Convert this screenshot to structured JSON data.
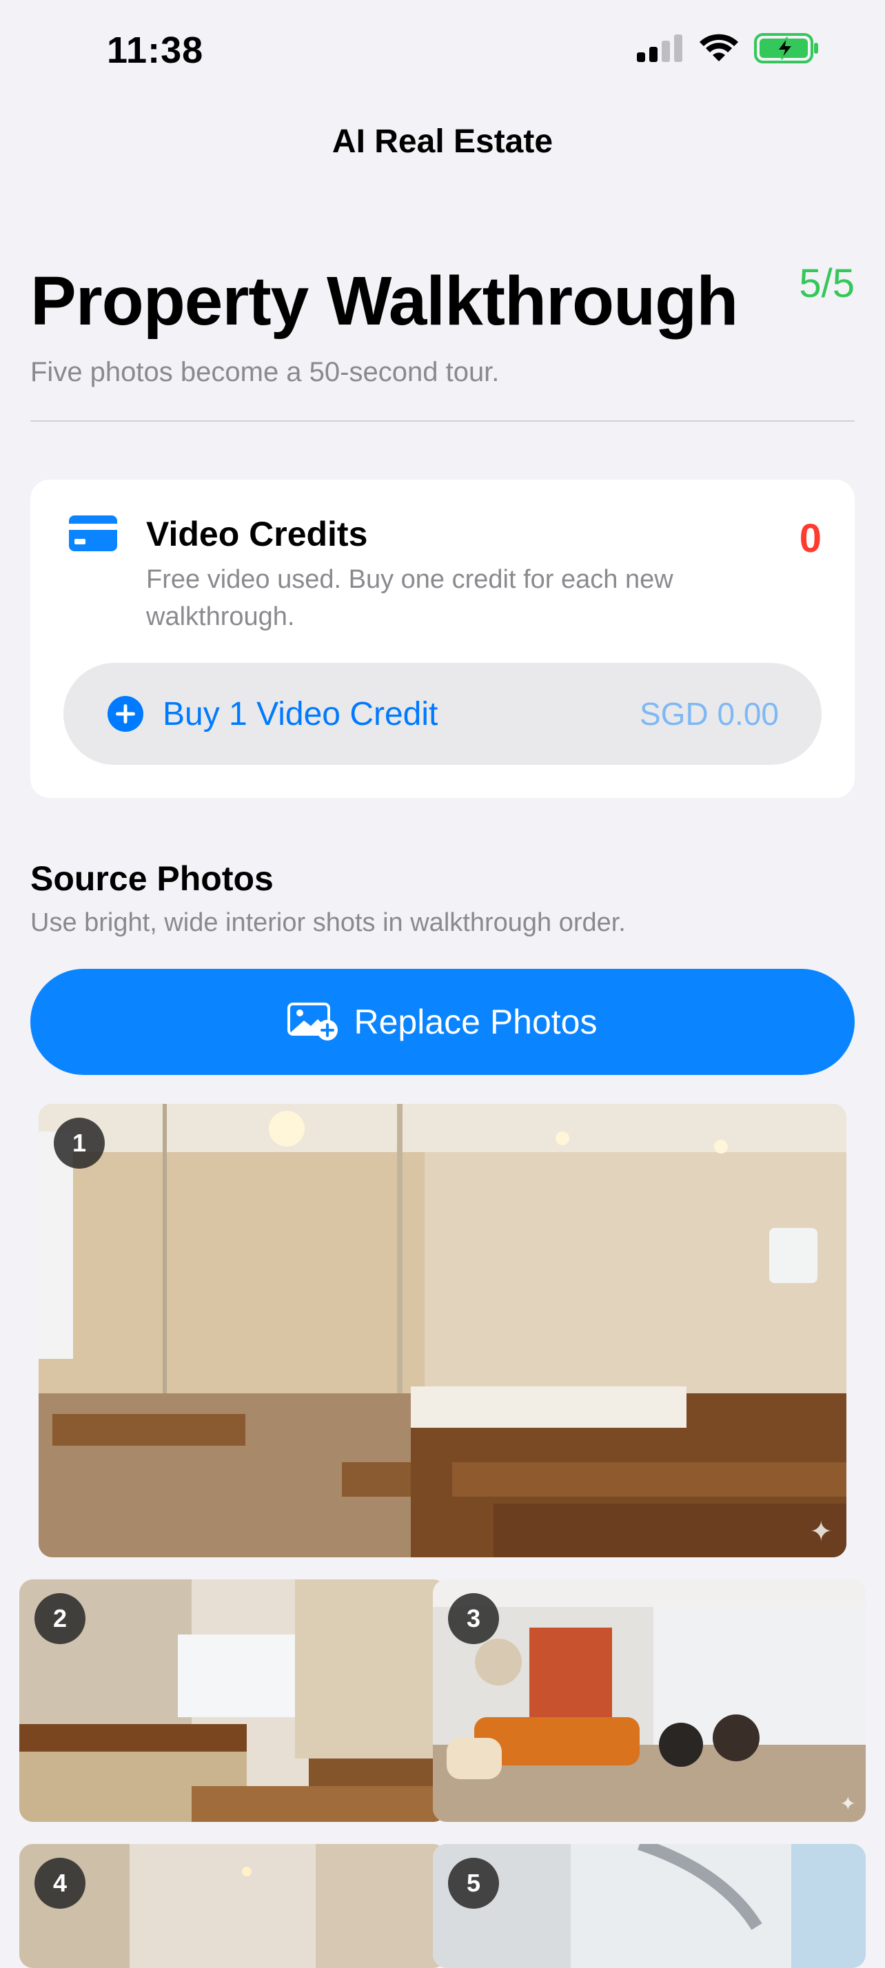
{
  "status_bar": {
    "time": "11:38"
  },
  "nav": {
    "title": "AI Real Estate"
  },
  "header": {
    "title": "Property Walkthrough",
    "counter": "5/5",
    "subtitle": "Five photos become a 50-second tour."
  },
  "credits": {
    "title": "Video Credits",
    "count": "0",
    "description": "Free video used. Buy one credit for each new walkthrough.",
    "buy_label": "Buy 1 Video Credit",
    "price": "SGD 0.00"
  },
  "source_photos": {
    "title": "Source Photos",
    "description": "Use bright, wide interior shots in walkthrough order.",
    "replace_label": "Replace Photos",
    "photos": [
      {
        "number": "1",
        "scene": "bathroom with glass shower and soaking tub"
      },
      {
        "number": "2",
        "scene": "bathroom vanity with mirror"
      },
      {
        "number": "3",
        "scene": "living room with orange sofa"
      },
      {
        "number": "4",
        "scene": "hallway"
      },
      {
        "number": "5",
        "scene": "spiral staircase"
      }
    ]
  },
  "colors": {
    "background": "#F2F2F7",
    "accent": "#007AFF",
    "counter_green": "#34C759",
    "credit_red": "#FF3B30"
  }
}
